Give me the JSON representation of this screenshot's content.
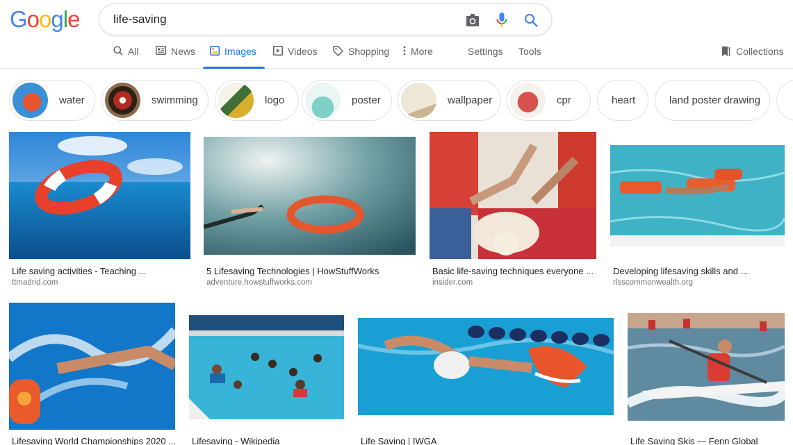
{
  "logo": {
    "letters": [
      "G",
      "o",
      "o",
      "g",
      "l",
      "e"
    ],
    "colors": [
      "#4285f4",
      "#ea4335",
      "#fbbc05",
      "#4285f4",
      "#34a853",
      "#ea4335"
    ]
  },
  "search": {
    "query": "life-saving",
    "placeholder": ""
  },
  "icons": {
    "camera": "camera-icon",
    "mic": "microphone-icon",
    "search": "search-icon"
  },
  "nav": {
    "tabs": [
      {
        "label": "All",
        "icon": "search-icon"
      },
      {
        "label": "News",
        "icon": "news-icon"
      },
      {
        "label": "Images",
        "icon": "image-icon",
        "active": true
      },
      {
        "label": "Videos",
        "icon": "play-icon"
      },
      {
        "label": "Shopping",
        "icon": "tag-icon"
      },
      {
        "label": "More",
        "icon": "dots-vertical-icon"
      }
    ],
    "settings": "Settings",
    "tools": "Tools",
    "collections": "Collections"
  },
  "chips": [
    {
      "label": "water"
    },
    {
      "label": "swimming"
    },
    {
      "label": "logo"
    },
    {
      "label": "poster"
    },
    {
      "label": "wallpaper"
    },
    {
      "label": "cpr"
    },
    {
      "label": "heart"
    },
    {
      "label": "land poster drawing"
    }
  ],
  "results": [
    {
      "title": "Life saving activities - Teaching ...",
      "source": "ttmadrid.com"
    },
    {
      "title": "5 Lifesaving Technologies | HowStuffWorks",
      "source": "adventure.howstuffworks.com"
    },
    {
      "title": "Basic life-saving techniques everyone ...",
      "source": "insider.com"
    },
    {
      "title": "Developing lifesaving skills and ...",
      "source": "rlsscommonwealth.org"
    },
    {
      "title": "Lifesaving World Championships 2020 ...",
      "source": ""
    },
    {
      "title": "Lifesaving - Wikipedia",
      "source": ""
    },
    {
      "title": "Life Saving | IWGA",
      "source": ""
    },
    {
      "title": "Life Saving Skis — Fenn Global",
      "source": ""
    }
  ],
  "accent": "#1a73e8"
}
